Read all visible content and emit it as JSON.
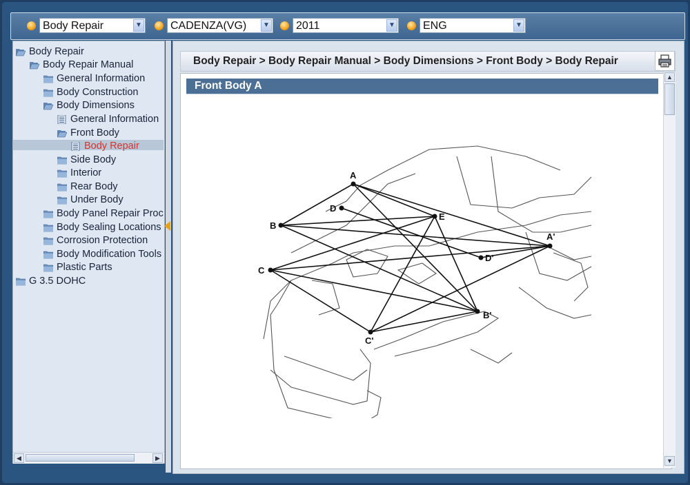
{
  "toolbar": {
    "selects": [
      {
        "value": "Body Repair"
      },
      {
        "value": "CADENZA(VG)"
      },
      {
        "value": "2011"
      },
      {
        "value": "ENG"
      }
    ]
  },
  "tree": {
    "items": [
      {
        "label": "Body Repair"
      },
      {
        "label": "Body Repair Manual"
      },
      {
        "label": "General Information"
      },
      {
        "label": "Body Construction"
      },
      {
        "label": "Body Dimensions"
      },
      {
        "label": "General Information"
      },
      {
        "label": "Front Body"
      },
      {
        "label": "Body Repair"
      },
      {
        "label": "Side Body"
      },
      {
        "label": "Interior"
      },
      {
        "label": "Rear Body"
      },
      {
        "label": "Under Body"
      },
      {
        "label": "Body Panel Repair Proc"
      },
      {
        "label": "Body Sealing Locations"
      },
      {
        "label": "Corrosion Protection"
      },
      {
        "label": "Body Modification Tools"
      },
      {
        "label": "Plastic Parts"
      },
      {
        "label": "G 3.5 DOHC"
      }
    ]
  },
  "main": {
    "breadcrumb": "Body Repair > Body Repair Manual > Body Dimensions > Front Body > Body Repair",
    "section_title": "Front Body A"
  },
  "diagram": {
    "points": [
      {
        "label": "A"
      },
      {
        "label": "B"
      },
      {
        "label": "C"
      },
      {
        "label": "D"
      },
      {
        "label": "E"
      },
      {
        "label": "A'"
      },
      {
        "label": "B'"
      },
      {
        "label": "C'"
      },
      {
        "label": "D'"
      }
    ]
  },
  "colors": {
    "selected_text": "#d9322a",
    "section_bar": "#4c6f95",
    "frame": "#2a5580"
  }
}
